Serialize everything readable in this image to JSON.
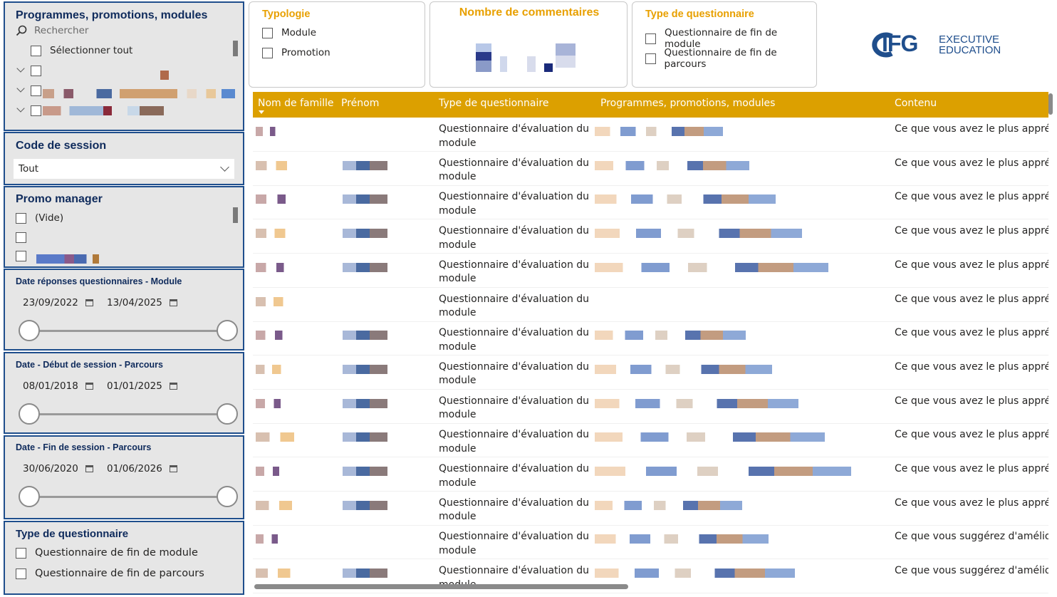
{
  "filters": {
    "programmes": {
      "title": "Programmes, promotions, modules",
      "search_placeholder": "Rechercher",
      "select_all": "Sélectionner tout"
    },
    "code_session": {
      "title": "Code de session",
      "selected": "Tout"
    },
    "promo_manager": {
      "title": "Promo manager",
      "options": [
        "(Vide)"
      ]
    },
    "date_module": {
      "title": "Date réponses questionnaires - Module",
      "start": "23/09/2022",
      "end": "13/04/2025",
      "range": [
        0,
        1
      ]
    },
    "date_debut": {
      "title": "Date - Début de session - Parcours",
      "start": "08/01/2018",
      "end": "01/01/2025",
      "range": [
        0,
        1
      ]
    },
    "date_fin": {
      "title": "Date - Fin de session - Parcours",
      "start": "30/06/2020",
      "end": "01/06/2026",
      "range": [
        0,
        1
      ]
    },
    "type_questionnaire_left": {
      "title": "Type de questionnaire",
      "options": [
        "Questionnaire de fin de module",
        "Questionnaire de fin de parcours"
      ]
    }
  },
  "cards": {
    "typologie": {
      "title": "Typologie",
      "options": [
        "Module",
        "Promotion"
      ]
    },
    "commentaires": {
      "title": "Nombre de commentaires"
    },
    "type_questionnaire": {
      "title": "Type de questionnaire",
      "options": [
        "Questionnaire de fin de module",
        "Questionnaire de fin de parcours"
      ]
    }
  },
  "logo": {
    "mark": "IFG",
    "line1": "EXECUTIVE",
    "line2": "EDUCATION",
    "color": "#1f4e8c"
  },
  "table": {
    "columns": [
      "Nom de famille",
      "Prénom",
      "Type de questionnaire",
      "Programmes, promotions, modules",
      "Contenu"
    ],
    "rows": [
      {
        "type": "Questionnaire d'évaluation du module",
        "contenu": "Ce que vous avez le plus appréc"
      },
      {
        "type": "Questionnaire d'évaluation du module",
        "contenu": "Ce que vous avez le plus appréc"
      },
      {
        "type": "Questionnaire d'évaluation du module",
        "contenu": "Ce que vous avez le plus appréc"
      },
      {
        "type": "Questionnaire d'évaluation du module",
        "contenu": "Ce que vous avez le plus appréc"
      },
      {
        "type": "Questionnaire d'évaluation du module",
        "contenu": "Ce que vous avez le plus appréc"
      },
      {
        "type": "Questionnaire d'évaluation du module",
        "contenu": "Ce que vous avez le plus appréc"
      },
      {
        "type": "Questionnaire d'évaluation du module",
        "contenu": "Ce que vous avez le plus appréc"
      },
      {
        "type": "Questionnaire d'évaluation du module",
        "contenu": "Ce que vous avez le plus appréc"
      },
      {
        "type": "Questionnaire d'évaluation du module",
        "contenu": "Ce que vous avez le plus appréc"
      },
      {
        "type": "Questionnaire d'évaluation du module",
        "contenu": "Ce que vous avez le plus appréc"
      },
      {
        "type": "Questionnaire d'évaluation du module",
        "contenu": "Ce que vous avez le plus appréc"
      },
      {
        "type": "Questionnaire d'évaluation du module",
        "contenu": "Ce que vous avez le plus appréc"
      },
      {
        "type": "Questionnaire d'évaluation du module",
        "contenu": "Ce que vous suggérez d'amélior"
      },
      {
        "type": "Questionnaire d'évaluation du module",
        "contenu": "Ce que vous suggérez d'amélior"
      }
    ]
  },
  "colors": {
    "header": "#dca000",
    "accent_title": "#e8a000",
    "panel_border": "#1f4e8c",
    "panel_bg": "#e6e6e6"
  }
}
